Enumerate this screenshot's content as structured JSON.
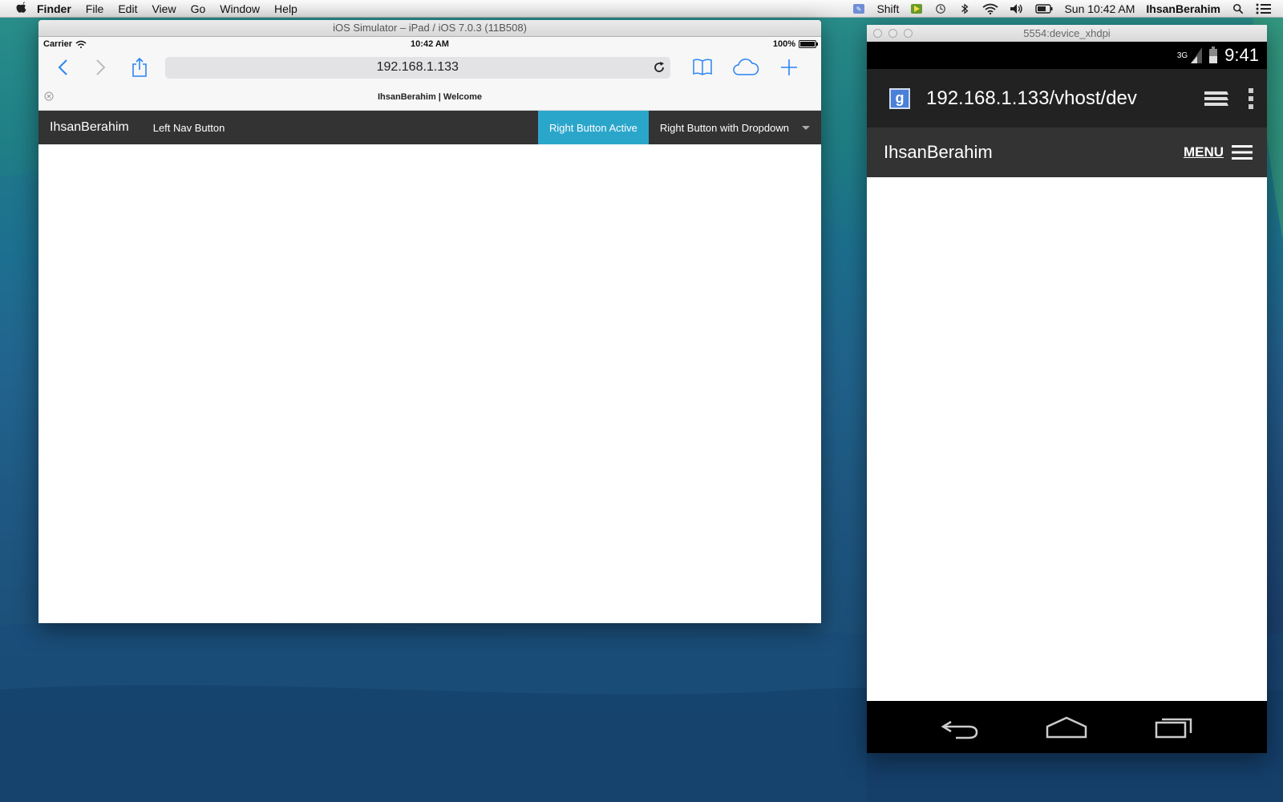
{
  "menubar": {
    "app_name": "Finder",
    "menus": [
      "File",
      "Edit",
      "View",
      "Go",
      "Window",
      "Help"
    ],
    "keyboard": "Shift",
    "clock": "Sun 10:42 AM",
    "user": "IhsanBerahim"
  },
  "ios_sim": {
    "window_title": "iOS Simulator – iPad / iOS 7.0.3 (11B508)",
    "carrier": "Carrier",
    "time": "10:42 AM",
    "battery": "100%",
    "url": "192.168.1.133",
    "tab_title": "IhsanBerahim | Welcome",
    "site": {
      "brand": "IhsanBerahim",
      "left_button": "Left Nav Button",
      "right_active": "Right Button Active",
      "right_dropdown": "Right Button with Dropdown",
      "active_color": "#2ba6cb"
    }
  },
  "android": {
    "window_title": "5554:device_xhdpi",
    "signal": "3G",
    "time": "9:41",
    "chrome_badge": "g",
    "url": "192.168.1.133/vhost/dev",
    "site": {
      "brand": "IhsanBerahim",
      "menu_label": "MENU"
    }
  }
}
